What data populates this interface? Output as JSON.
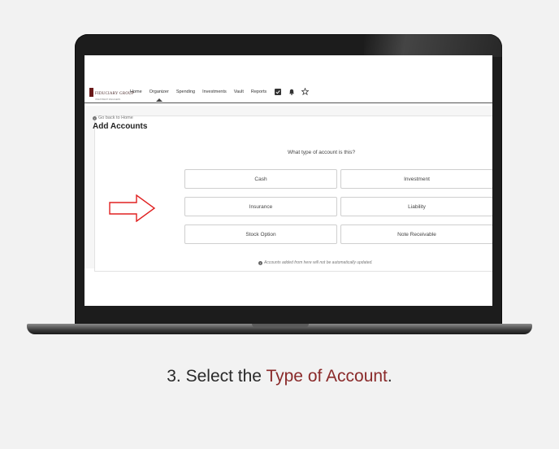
{
  "nav": {
    "logo_text": "FIDUCIARY GROUP",
    "logo_sub": "INVESTMENT MANAGERS",
    "items": [
      "Home",
      "Organizer",
      "Spending",
      "Investments",
      "Vault",
      "Reports"
    ],
    "active_item": "Organizer",
    "icons": [
      "checkbox-icon",
      "bell-icon",
      "star-icon"
    ]
  },
  "page": {
    "back_link": "Go back to Home",
    "title": "Add Accounts",
    "question": "What type of account is this?",
    "account_types": [
      "Cash",
      "Investment",
      "Insurance",
      "Liability",
      "Stock Option",
      "Note Receivable"
    ],
    "note": "Accounts added from here will not be automatically updated."
  },
  "annotation": {
    "arrow_color": "#e02020"
  },
  "caption": {
    "prefix": "3. Select the ",
    "highlight": "Type of Account",
    "suffix": "."
  },
  "colors": {
    "accent": "#8a2a2a",
    "laptop": "#1c1c1c"
  }
}
